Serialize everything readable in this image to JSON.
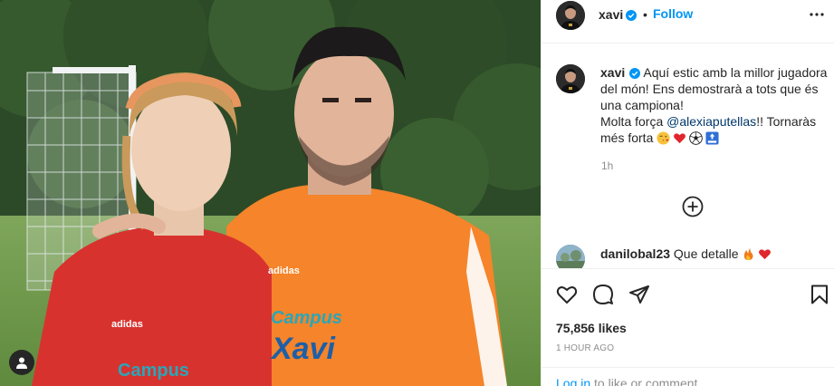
{
  "post": {
    "photo_alt": "",
    "jersey_left_brand": "adidas",
    "jersey_left_text": "Campus",
    "jersey_right_brand": "adidas",
    "jersey_right_text1": "Campus",
    "jersey_right_text2": "Xavi"
  },
  "header": {
    "username": "xavi",
    "dot": "•",
    "follow_label": "Follow",
    "more_icon": "more-icon"
  },
  "caption": {
    "username": "xavi",
    "line1": "Aquí estic amb la millor jugadora del món! Ens demostrarà a tots que és una campiona!",
    "line2_prefix": "Molta força ",
    "mention": "@alexiaputellas",
    "line2_suffix": "!! Tornaràs més forta",
    "emojis": [
      "face-blowing-kiss",
      "red-heart",
      "soccer-ball",
      "top-arrow"
    ],
    "time": "1h"
  },
  "comment": {
    "username": "danilobal23",
    "text": "Que detalle",
    "emojis": [
      "fire",
      "red-heart"
    ]
  },
  "actions": {
    "likes": "75,856 likes",
    "ago": "1 HOUR AGO",
    "login_link": "Log in",
    "login_text": " to like or comment."
  },
  "colors": {
    "accent": "#0095f6",
    "text": "#262626",
    "muted": "#8e8e8e",
    "border": "#efefef",
    "jersey_orange": "#f5842a",
    "jersey_red": "#d8322f"
  }
}
